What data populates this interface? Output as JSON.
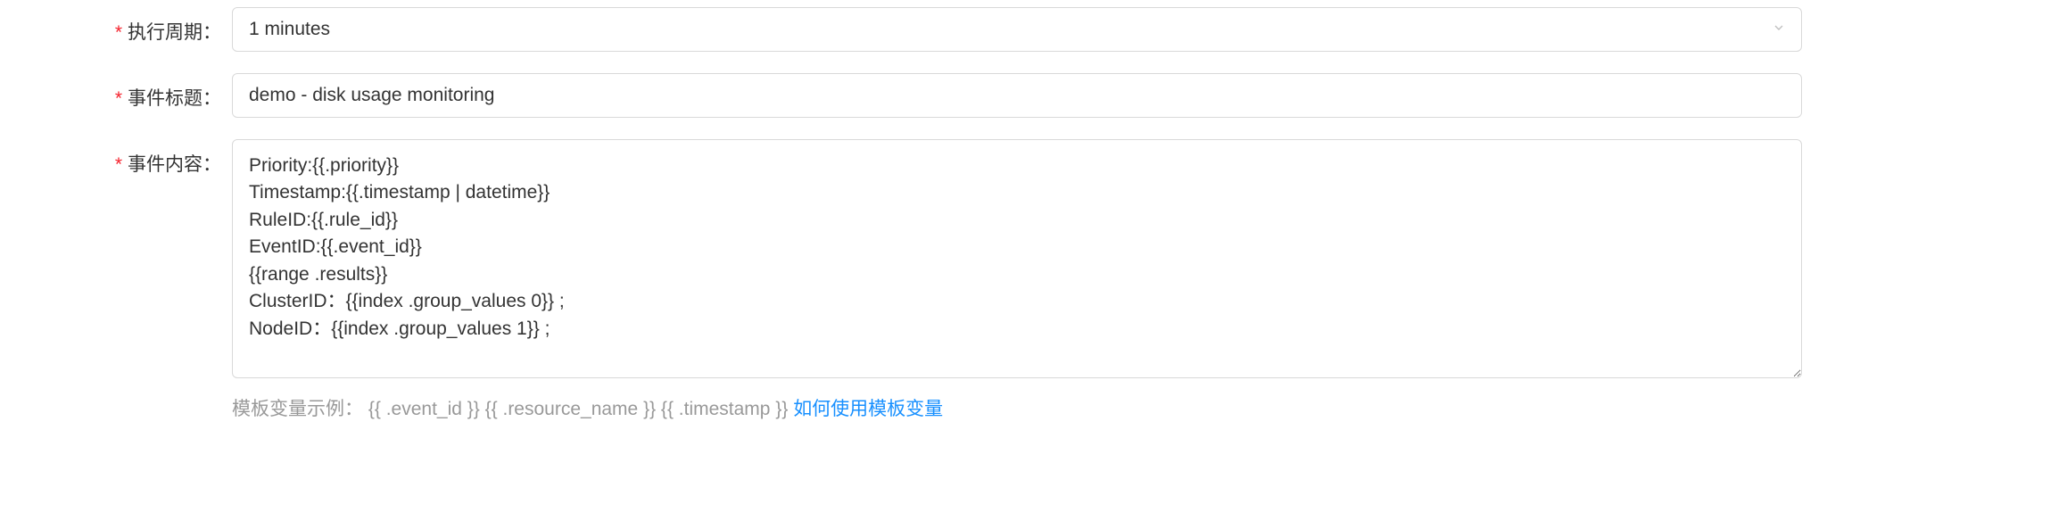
{
  "fields": {
    "execution_period": {
      "label": "执行周期：",
      "value": "1 minutes"
    },
    "event_title": {
      "label": "事件标题：",
      "value": "demo - disk usage monitoring"
    },
    "event_content": {
      "label": "事件内容：",
      "value": "Priority:{{.priority}}\nTimestamp:{{.timestamp | datetime}}\nRuleID:{{.rule_id}}\nEventID:{{.event_id}}\n{{range .results}}\nClusterID：{{index .group_values 0}} ;\nNodeID：{{index .group_values 1}} ;"
    }
  },
  "helper": {
    "prefix": "模板变量示例：  {{ .event_id }} {{ .resource_name }} {{ .timestamp }} ",
    "link_text": "如何使用模板变量"
  }
}
